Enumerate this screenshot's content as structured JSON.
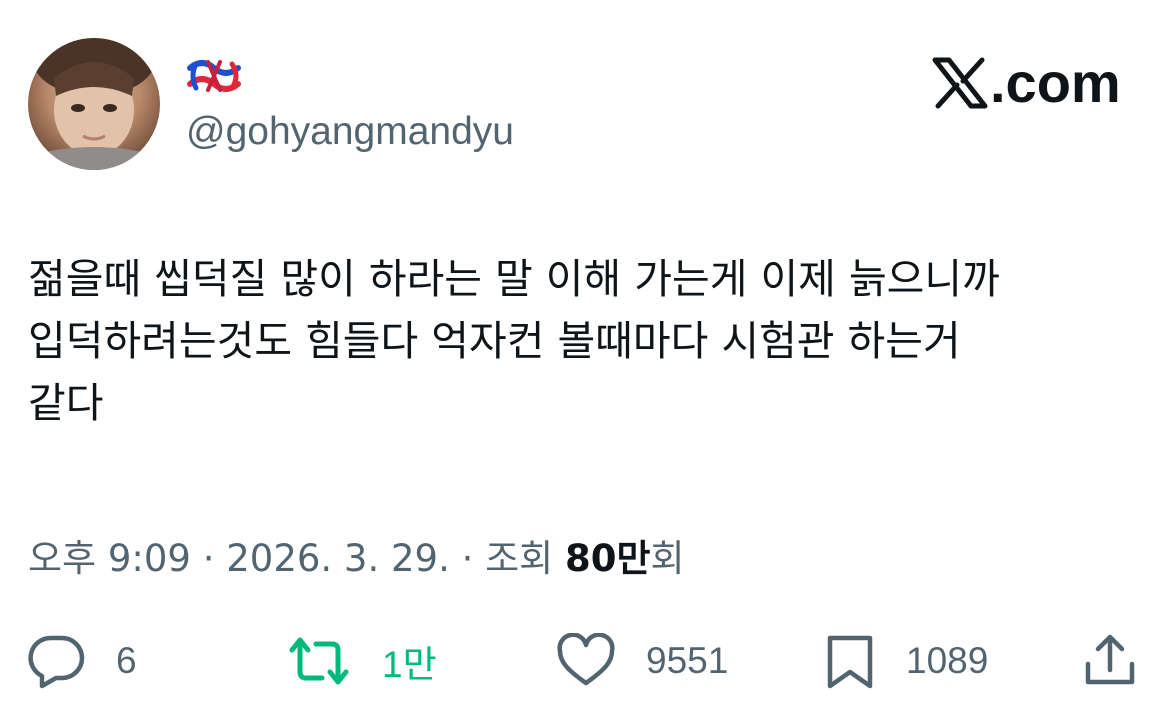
{
  "author": {
    "display_name_icon": "rope-knot-emoji",
    "handle": "@gohyangmandyu"
  },
  "brand": {
    "logo_text": ".com",
    "icon": "x-logo-icon"
  },
  "tweet": {
    "lines": [
      "젊을때 씹덕질 많이 하라는 말 이해 가는게 이제 늙으니까",
      "입덕하려는것도 힘들다 억자컨 볼때마다 시험관 하는거",
      "같다"
    ]
  },
  "meta": {
    "time": "오후 9:09",
    "separator": "·",
    "date": "2026. 3. 29.",
    "views_label": "조회",
    "views_value": "80만",
    "views_suffix": "회"
  },
  "actions": {
    "reply": {
      "icon": "reply-bubble-icon",
      "count": "6"
    },
    "retweet": {
      "icon": "retweet-icon",
      "count": "1만",
      "color": "#00ba7c"
    },
    "like": {
      "icon": "heart-icon",
      "count": "9551"
    },
    "bookmark": {
      "icon": "bookmark-icon",
      "count": "1089"
    },
    "share": {
      "icon": "share-icon"
    }
  },
  "colors": {
    "text": "#0f1419",
    "secondary": "#536471",
    "retweet": "#00ba7c"
  }
}
